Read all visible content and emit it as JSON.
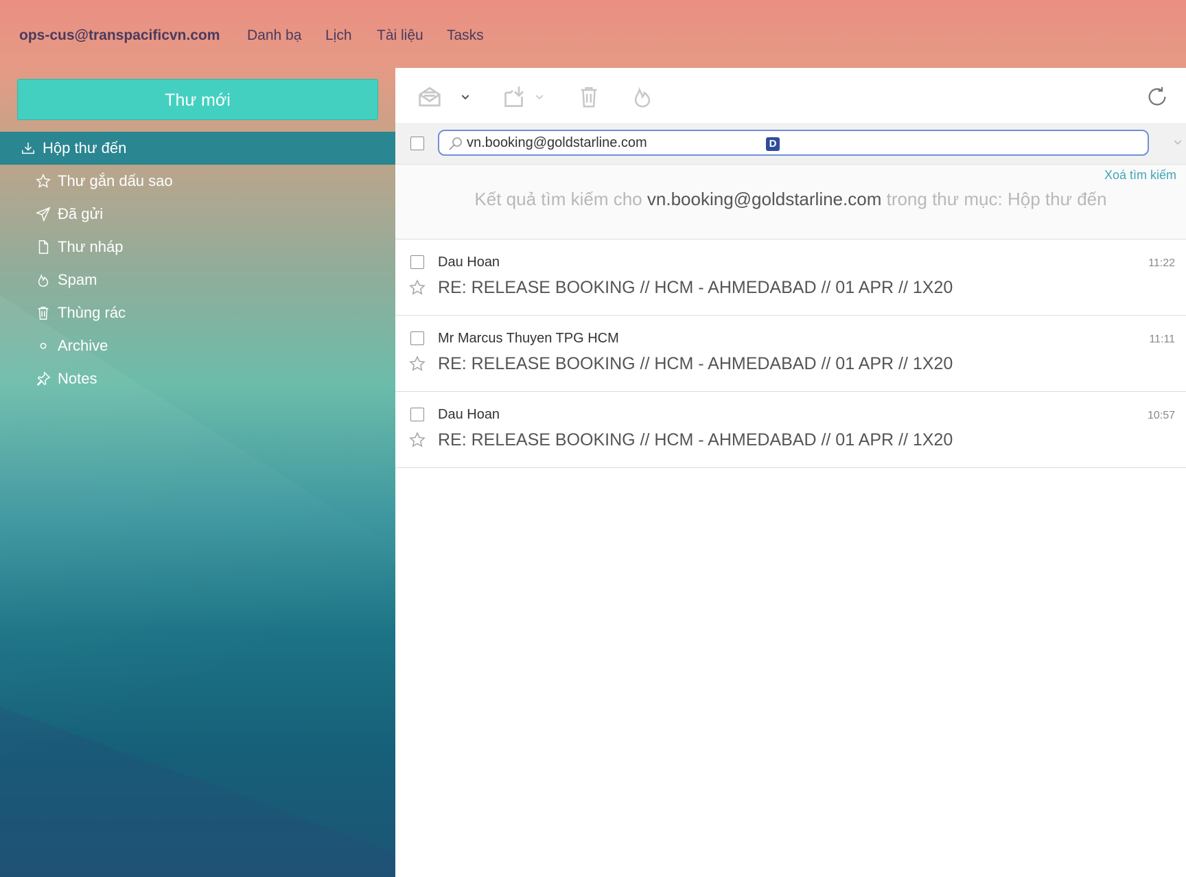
{
  "header": {
    "account": "ops-cus@transpacificvn.com",
    "nav": [
      "Danh bạ",
      "Lịch",
      "Tài liệu",
      "Tasks"
    ]
  },
  "sidebar": {
    "compose_label": "Thư mới",
    "folders": [
      {
        "label": "Hộp thư đến",
        "icon": "inbox-download-icon",
        "active": true
      },
      {
        "label": "Thư gắn dấu sao",
        "icon": "star-icon"
      },
      {
        "label": "Đã gửi",
        "icon": "paper-plane-icon"
      },
      {
        "label": "Thư nháp",
        "icon": "draft-document-icon"
      },
      {
        "label": "Spam",
        "icon": "flame-icon"
      },
      {
        "label": "Thùng rác",
        "icon": "trash-icon"
      },
      {
        "label": "Archive",
        "icon": "circle-icon"
      },
      {
        "label": "Notes",
        "icon": "pin-icon"
      }
    ]
  },
  "toolbar": {
    "icons": [
      "mark-read-icon",
      "chevron-down-icon",
      "move-folder-icon",
      "chevron-down-icon",
      "trash-icon",
      "flame-icon",
      "refresh-icon"
    ]
  },
  "search": {
    "value": "vn.booking@goldstarline.com",
    "badge": "D",
    "clear_label": "Xoá tìm kiếm",
    "result_prefix": "Kết quả tìm kiếm cho",
    "result_query": "vn.booking@goldstarline.com",
    "result_suffix": "trong thư mục: Hộp thư đến"
  },
  "messages": [
    {
      "sender": "Dau Hoan",
      "time": "11:22",
      "subject": "RE: RELEASE BOOKING // HCM - AHMEDABAD // 01 APR // 1X20"
    },
    {
      "sender": "Mr Marcus Thuyen TPG HCM",
      "time": "11:11",
      "subject": "RE: RELEASE BOOKING // HCM - AHMEDABAD // 01 APR // 1X20"
    },
    {
      "sender": "Dau Hoan",
      "time": "10:57",
      "subject": "RE: RELEASE BOOKING // HCM - AHMEDABAD // 01 APR // 1X20"
    }
  ],
  "colors": {
    "compose_bg": "#44d0c0",
    "active_folder_bg": "#2a8690",
    "link": "#3fa7b5",
    "search_border": "#6f8fd8"
  }
}
